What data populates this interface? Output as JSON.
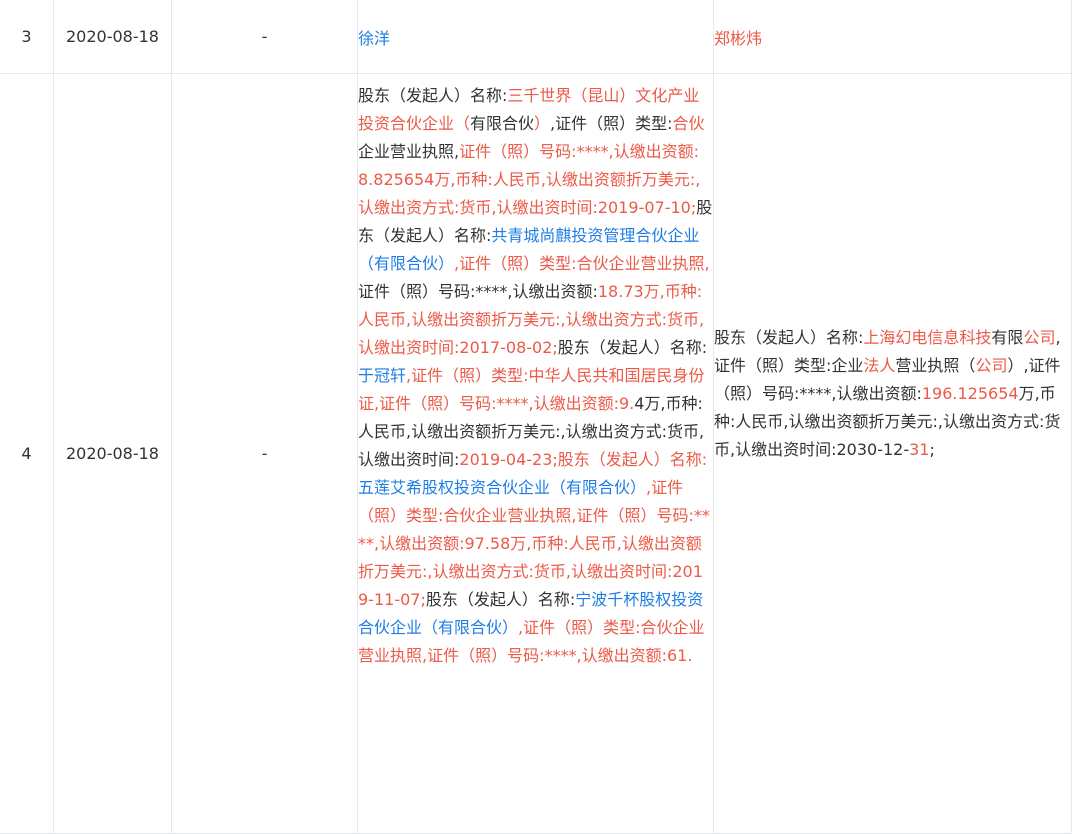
{
  "rows": [
    {
      "index": "3",
      "date": "2020-08-18",
      "item": "-",
      "before": "徐洋",
      "after": "郑彬炜"
    },
    {
      "index": "4",
      "date": "2020-08-18",
      "item": "-",
      "before_segments": [
        {
          "t": "股东（发起人）名称:",
          "c": "n"
        },
        {
          "t": "三千世界（昆山）文化产业投资合伙企业（",
          "c": "r"
        },
        {
          "t": "有限合伙",
          "c": "n"
        },
        {
          "t": "）",
          "c": "r"
        },
        {
          "t": ",证件（照）类型:",
          "c": "n"
        },
        {
          "t": "合伙",
          "c": "r"
        },
        {
          "t": "企业营业执照,",
          "c": "n"
        },
        {
          "t": "证件（照）号码:****,认缴出资额:8.825654万,币种:人民币,认缴出资额折万美元:,认缴出资方式:货币,认缴出资时间:2019-07-10;",
          "c": "r"
        },
        {
          "t": "股东（发起人）名称:",
          "c": "n"
        },
        {
          "t": "共青城尚麒投资管理合伙企业（有限合伙）",
          "c": "b"
        },
        {
          "t": ",证件（照）类型:合伙企业营业执照,",
          "c": "r"
        },
        {
          "t": "证件（照）号码:****,认缴出资额:",
          "c": "n"
        },
        {
          "t": "18.73万,币种:人民币,认缴出资额折万美元:,认缴出资方式:货币,认缴出资时间:2017-08-02;",
          "c": "r"
        },
        {
          "t": "股东（发起人）名称:",
          "c": "n"
        },
        {
          "t": "于冠轩",
          "c": "b"
        },
        {
          "t": ",证件（照）类型:中华人民共和国居民身份证,证件（照）号码:****,认缴出资额:9.",
          "c": "r"
        },
        {
          "t": "4万,币种:人民币,认缴出资额折万美元:,认缴出资方式:货币,认缴出资时间:",
          "c": "n"
        },
        {
          "t": "2019-04-23;",
          "c": "r"
        },
        {
          "t": "股东（发起人）名称:",
          "c": "r"
        },
        {
          "t": "五莲艾希股权投资合伙企业（有限合伙）",
          "c": "b"
        },
        {
          "t": ",证件（照）类型:合伙企业营业执照,证件（照）号码:****,认缴出资额:97.58万,币种:人民币,认缴出资额折万美元:,认缴出资方式:货币,认缴出资时间:2019-11-07;",
          "c": "r"
        },
        {
          "t": "股东（发起人）名称:",
          "c": "n"
        },
        {
          "t": "宁波千杯股权投资合伙企业（有限合伙）",
          "c": "b"
        },
        {
          "t": ",证件（照）类型:合伙企业营业执照,证件（照）号码:****,认缴出资额:61.",
          "c": "r"
        }
      ],
      "after_segments": [
        {
          "t": "股东（发起人）名称:",
          "c": "n"
        },
        {
          "t": "上海幻电信息科技",
          "c": "r"
        },
        {
          "t": "有限",
          "c": "n"
        },
        {
          "t": "公司",
          "c": "r"
        },
        {
          "t": ",证件（照）类型:企业",
          "c": "n"
        },
        {
          "t": "法人",
          "c": "r"
        },
        {
          "t": "营业执照（",
          "c": "n"
        },
        {
          "t": "公司",
          "c": "r"
        },
        {
          "t": "）,证件（照）号码:****,认缴出资额:",
          "c": "n"
        },
        {
          "t": "196.125654",
          "c": "r"
        },
        {
          "t": "万,币种:人民币,认缴出资额折万美元:,认缴出资方式:货币,认缴出资时间:2030-12-",
          "c": "n"
        },
        {
          "t": "31",
          "c": "r"
        },
        {
          "t": ";",
          "c": "n"
        }
      ]
    }
  ]
}
